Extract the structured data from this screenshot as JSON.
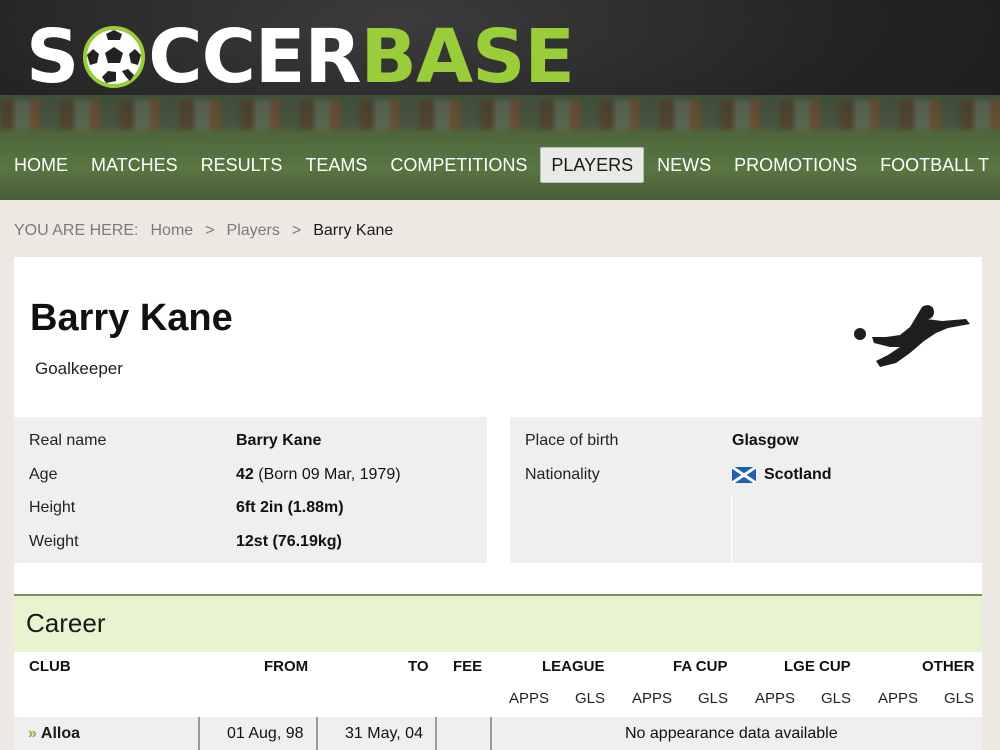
{
  "header": {
    "logo_part1": "S",
    "logo_part2": "CCER",
    "logo_part3": "BASE",
    "accent_color": "#9acd3a"
  },
  "nav": {
    "items": [
      {
        "label": "HOME"
      },
      {
        "label": "MATCHES"
      },
      {
        "label": "RESULTS"
      },
      {
        "label": "TEAMS"
      },
      {
        "label": "COMPETITIONS"
      },
      {
        "label": "PLAYERS",
        "active": true
      },
      {
        "label": "NEWS"
      },
      {
        "label": "PROMOTIONS"
      },
      {
        "label": "FOOTBALL T"
      }
    ]
  },
  "breadcrumb": {
    "prefix": "YOU ARE HERE:",
    "items": [
      "Home",
      "Players",
      "Barry Kane"
    ],
    "separator": ">"
  },
  "player": {
    "name": "Barry Kane",
    "position": "Goalkeeper",
    "icon": "goalkeeper-silhouette-icon"
  },
  "info_left": [
    {
      "label": "Real name",
      "value": "Barry Kane"
    },
    {
      "label": "Age",
      "value_bold": "42",
      "value_rest": " (Born 09 Mar, 1979)"
    },
    {
      "label": "Height",
      "value": "6ft 2in (1.88m)"
    },
    {
      "label": "Weight",
      "value": "12st (76.19kg)"
    }
  ],
  "info_right": [
    {
      "label": "Place of birth",
      "value": "Glasgow"
    },
    {
      "label": "Nationality",
      "value": "Scotland",
      "flag": "scotland-flag-icon"
    }
  ],
  "career": {
    "title": "Career",
    "columns": {
      "club": "CLUB",
      "from": "FROM",
      "to": "TO",
      "fee": "FEE",
      "league": "LEAGUE",
      "fa_cup": "FA CUP",
      "lge_cup": "LGE CUP",
      "other": "OTHER"
    },
    "sub_columns": {
      "apps": "APPS",
      "gls": "GLS"
    },
    "rows": [
      {
        "club": "Alloa",
        "from": "01 Aug, 98",
        "to": "31 May, 04",
        "fee": "",
        "note": "No appearance data available"
      }
    ]
  }
}
